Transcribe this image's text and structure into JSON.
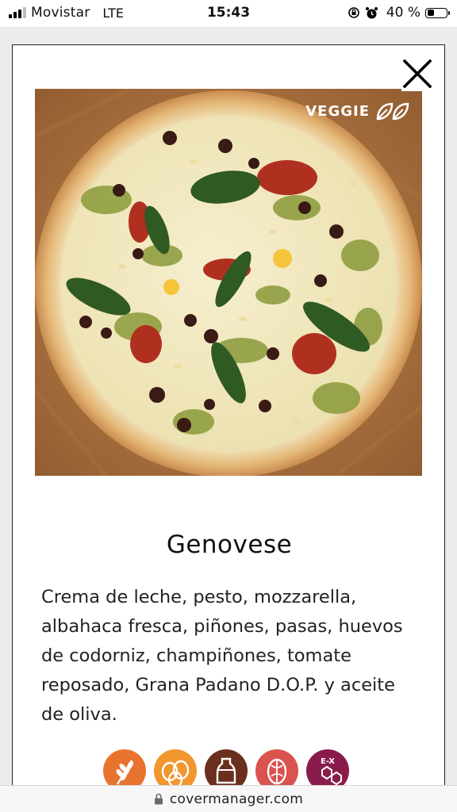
{
  "status_bar": {
    "carrier": "Movistar",
    "network": "LTE",
    "time": "15:43",
    "battery": "40 %",
    "battery_level": 0.4
  },
  "modal": {
    "close_icon": "close-icon",
    "image": {
      "subject": "pizza-photo",
      "badge_label": "VEGGIE",
      "badge_icon": "leaves-icon"
    },
    "title": "Genovese",
    "description": "Crema de leche, pesto, mozzarella, albahaca fresca, piñones, pasas, huevos de codorniz, champiñones, tomate reposado, Grana Padano D.O.P. y aceite de oliva.",
    "allergens": [
      {
        "icon": "gluten-wheat-icon",
        "color": "#e8732f"
      },
      {
        "icon": "egg-icon",
        "color": "#f2962e"
      },
      {
        "icon": "milk-icon",
        "color": "#6b2f1f"
      },
      {
        "icon": "nuts-icon",
        "color": "#d9534f"
      },
      {
        "icon": "sulphites-icon",
        "color": "#8a1c4b",
        "label": "E-X"
      }
    ]
  },
  "browser": {
    "url": "covermanager.com",
    "lock_icon": "lock-icon"
  }
}
